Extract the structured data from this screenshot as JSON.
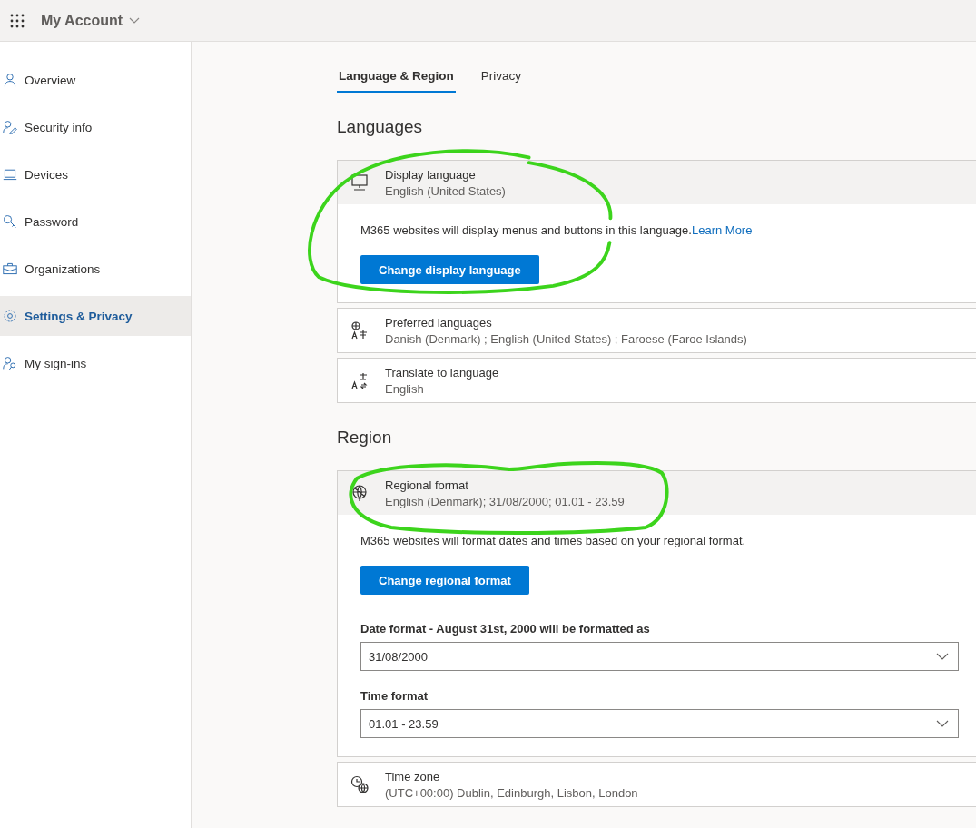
{
  "header": {
    "app_title": "My Account"
  },
  "sidebar": {
    "items": [
      {
        "label": "Overview",
        "selected": false
      },
      {
        "label": "Security info",
        "selected": false
      },
      {
        "label": "Devices",
        "selected": false
      },
      {
        "label": "Password",
        "selected": false
      },
      {
        "label": "Organizations",
        "selected": false
      },
      {
        "label": "Settings & Privacy",
        "selected": true
      },
      {
        "label": "My sign-ins",
        "selected": false
      }
    ]
  },
  "tabs": [
    {
      "label": "Language & Region",
      "selected": true
    },
    {
      "label": "Privacy",
      "selected": false
    }
  ],
  "sections": [
    {
      "heading": "Languages",
      "settings": [
        {
          "title": "Display language",
          "value": "English (United States)",
          "expanded": true,
          "description": "M365 websites will display menus and buttons in this language.",
          "link": "Learn More",
          "button": "Change display language"
        },
        {
          "title": "Preferred languages",
          "value": "Danish (Denmark) ; English (United States) ; Faroese (Faroe Islands)",
          "expanded": false
        },
        {
          "title": "Translate to language",
          "value": "English",
          "expanded": false
        }
      ]
    },
    {
      "heading": "Region",
      "settings": [
        {
          "title": "Regional format",
          "value": "English (Denmark); 31/08/2000; 01.01 - 23.59",
          "expanded": true,
          "description": "M365 websites will format dates and times based on your regional format.",
          "button": "Change regional format",
          "dropdowns": [
            {
              "label": "Date format - August 31st, 2000 will be formatted as",
              "value": "31/08/2000"
            },
            {
              "label": "Time format",
              "value": "01.01 - 23.59"
            }
          ]
        },
        {
          "title": "Time zone",
          "value": "(UTC+00:00) Dublin, Edinburgh, Lisbon, London",
          "expanded": false
        }
      ]
    }
  ]
}
